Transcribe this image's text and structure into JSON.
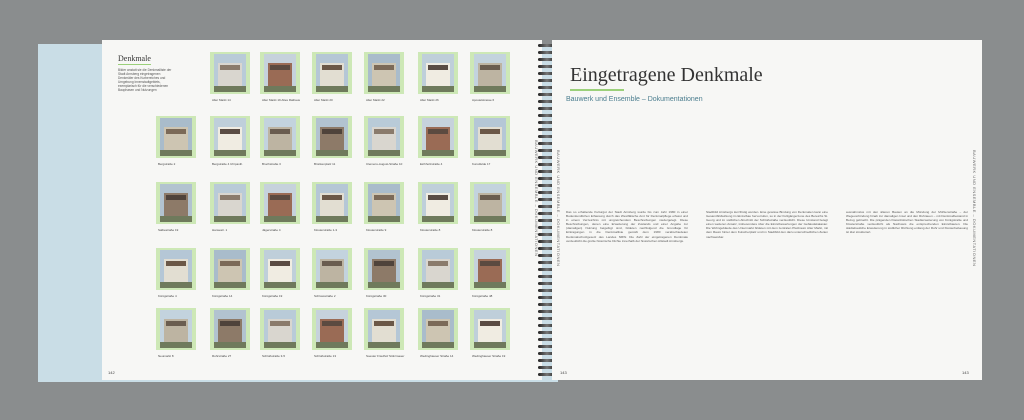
{
  "left_page": {
    "title": "Denkmale",
    "intro": "Bilder anstatt sie die Denkmalliste der Stadt Arnsberg eingetragenen Denkmäler des Kurbereiches und Umgebung Innenstadtgebiets, exemplarisch für die verschiedenen Bauphasen und Nutzungen",
    "side_label": "BAUWERK UND ENSEMBLE – DOKUMENTATIONEN",
    "page_number": "142",
    "captions": [
      "Alter Markt 14",
      "Alter Markt 19 Altes Rathaus",
      "Alter Markt 20",
      "Alter Markt 22",
      "Alter Markt 26",
      "Apostelstrasse 6",
      "Bergstraße 2",
      "Bergstraße 4 Uhrpavill.",
      "Bruchstraße 3",
      "Brückenplatz 11",
      "Clemens-August-Straße 10",
      "Eichholzstraße 4",
      "Kunstfelde 17",
      "Salbestraße 19",
      "Hansestr. 1",
      "Jägerstraße 4",
      "Klosterstraße 1-3",
      "Klosterstraße 9",
      "Klosterstraße 8",
      "Klosterstraße 8",
      "Königstraße 4",
      "Königstraße 14",
      "Königstraße 19",
      "Schlossstraße 2",
      "Königstraße 30",
      "Königstraße 31",
      "Königstraße 48",
      "Neumarkt 8",
      "Ruhrstraße 27",
      "Schloßstraße 3-5",
      "Schloßstraße 13",
      "Soester Friedhof Stützmauer",
      "Wedinghauser Straße 14",
      "Wedinghauser Straße 19"
    ]
  },
  "right_page": {
    "title": "Eingetragene Denkmale",
    "subtitle": "Bauwerk und Ensemble – Dokumentationen",
    "side_label": "BAUWERK UND ENSEMBLE – DOKUMENTATIONEN",
    "page_number_left": "143",
    "page_number_right": "143",
    "columns": [
      "Das so erhaltende Kulturgut der Stadt Arnsberg wurde bis zum Jahr 1980 in einer Bodenkundlichen Erfassung durch das Westfälische Amt für Denkmalpflege erfasst und in einem Verzeichnis mit umgreichendem Beschreibungen niedergelegt. Diese Beschreibungen, denen eine Erweiterung der Zustands und einer Angabe zur (damaligen) Nutzung beigefügt sind, bildeten nachfolgend die Grundlage für Eintragungen in die Denkmalliste gemäß dem 1980 verabschiedeten Denkmalschutzgesetz des Landes NRW. Die Zahl der eingetragenen Denkmale verdeutlicht die große historische Dichte innerhalb der historischen Altstadt Arnsbergs.",
      "Stadtbild Arnsbergs kurzfristig werden. Eine gewisse Bindung von Denkmalen kann eine Gesamtbildwirkung im Einzelbau hervorrufen, so in der Fußgängerzone des Bereichs St. Georg und im südlichen Abschnitt der Schloßstraße verdeutlicht. Diese Umstand belegt einen weiteren Ansatz, insbesondere über die Einzelbewertungen der Gebäudekataster. Die Wohngebäude des Untermarkt bildeten mit dem zentralen Platzraum Alter Markt, mit dem Raum hinter dem Kutscherplatz und im Stadtbild den dazu unterschiedlichen Zeiten nachweisbar.",
      "ausnahmslos mit den älteren Bauten an die Mündung der Mühlenstraße – der Wegeverbindung hinab zur damaligen Insel und den Ruhrauen – mit Denkmalbestand in Bezug gebracht. Die prägenden Klassizistischen Stadterweiterung von Königstraße und Klosterstraße verdeutlicht als Nachweis die entsprechenden Einzelbauten. Die städtebauliche Erweiterung in südlicher Richtung entlang der Ruhr und Klosterbebauung ist klar strukturiert."
    ]
  }
}
